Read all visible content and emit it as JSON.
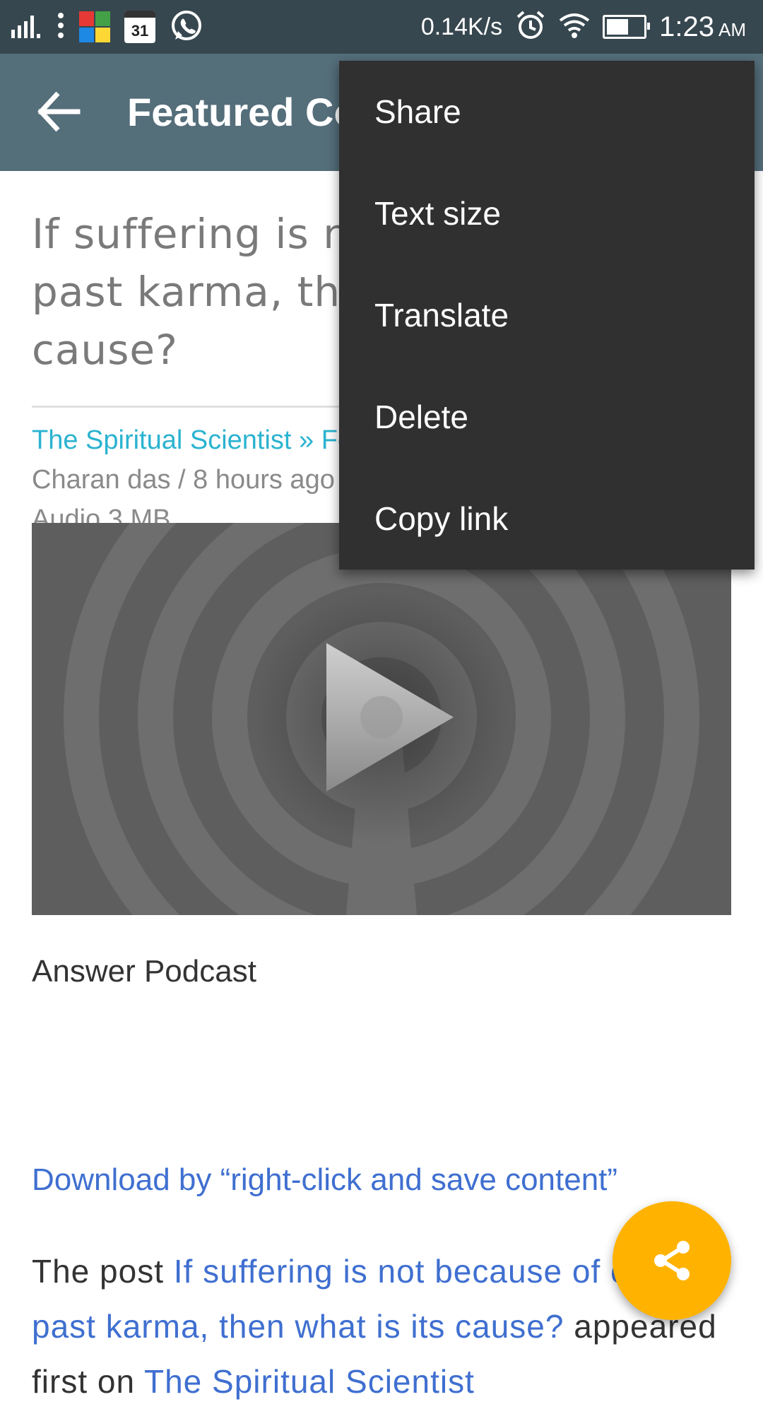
{
  "status_bar": {
    "network_speed": "0.14K/s",
    "time": "1:23",
    "ampm": "AM",
    "calendar_day": "31",
    "battery_level": 0.6,
    "icons": [
      "signal-icon",
      "more-vert-icon",
      "avg-icon",
      "calendar-icon",
      "whatsapp-icon",
      "alarm-icon",
      "wifi-icon",
      "battery-icon"
    ]
  },
  "app_bar": {
    "title": "Featured Content",
    "back_icon": "arrow-back-icon"
  },
  "article": {
    "headline": "If suffering is not because of our past karma, then what is its cause?",
    "source_link": "The Spiritual Scientist » Featured Content",
    "author_time": "Charan das / 8 hours ago",
    "attachment": "Audio 3 MB",
    "media_caption": "Answer Podcast",
    "download_link": "Download by “right-click and save content”",
    "post_prefix": "The post ",
    "post_link": "If suffering is not because of our past karma, then what is its cause?",
    "post_middle": " appeared first on ",
    "post_site": "The Spiritual Scientist"
  },
  "overflow_menu": {
    "items": [
      "Share",
      "Text size",
      "Translate",
      "Delete",
      "Copy link"
    ]
  },
  "fab": {
    "icon": "share-icon",
    "color": "#ffb300"
  },
  "colors": {
    "status_bar": "#37474f",
    "app_bar": "#546e7a",
    "menu_bg": "#303030",
    "link": "#3f6fd0",
    "source_link": "#2bb3d0"
  }
}
